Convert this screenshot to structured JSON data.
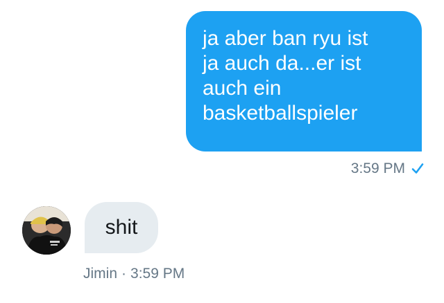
{
  "sent_message": {
    "text": "ja aber ban ryu ist\nja auch da...er ist\nauch ein\nbasketballspieler",
    "time": "3:59 PM",
    "status_icon": "checkmark-icon"
  },
  "received_message": {
    "sender": "Jimin",
    "separator": "·",
    "text": "shit",
    "time": "3:59 PM",
    "avatar_icon": "avatar-image"
  },
  "colors": {
    "sent_bubble": "#1da1f2",
    "received_bubble": "#e6ecf0",
    "meta_text": "#657786",
    "check": "#1da1f2"
  }
}
